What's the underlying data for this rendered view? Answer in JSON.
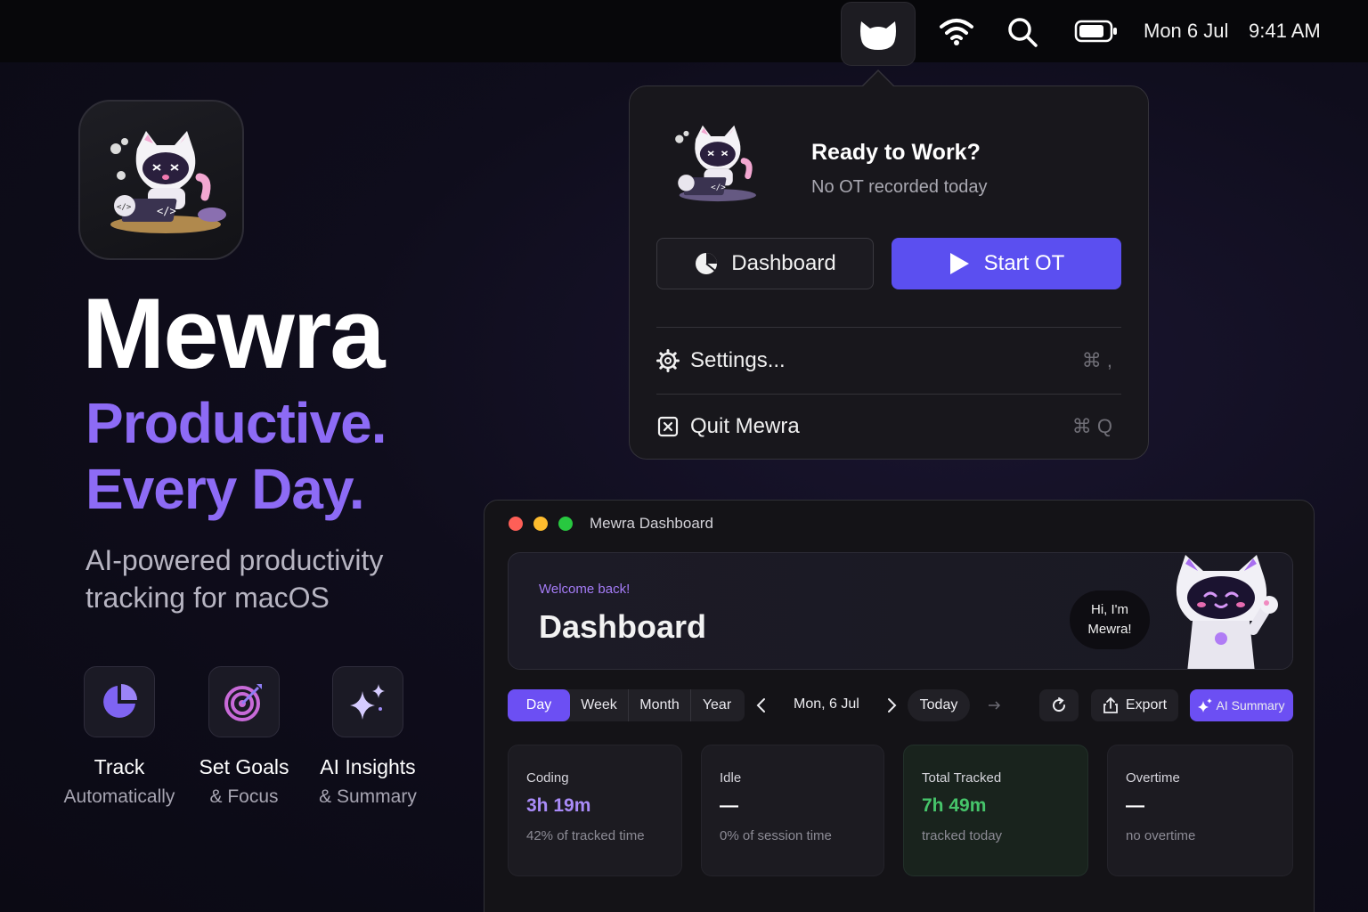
{
  "menubar": {
    "date": "Mon 6 Jul",
    "time": "9:41 AM",
    "icons": [
      "cat-app-icon",
      "wifi-icon",
      "search-icon",
      "battery-icon"
    ]
  },
  "hero": {
    "brand": "Mewra",
    "tagline_line1": "Productive.",
    "tagline_line2": "Every Day.",
    "description": "AI-powered productivity tracking for macOS",
    "accent": "#8d6bf5",
    "features": [
      {
        "icon": "pie-chart-icon",
        "title": "Track",
        "subtitle": "Automatically"
      },
      {
        "icon": "target-icon",
        "title": "Set Goals",
        "subtitle": "& Focus"
      },
      {
        "icon": "sparkles-icon",
        "title": "AI Insights",
        "subtitle": "& Summary"
      }
    ]
  },
  "popover": {
    "title": "Ready to Work?",
    "subtitle": "No OT recorded today",
    "dashboard_label": "Dashboard",
    "start_label": "Start OT",
    "settings_label": "Settings...",
    "settings_shortcut": "⌘ ,",
    "quit_label": "Quit Mewra",
    "quit_shortcut": "⌘ Q",
    "start_color": "#5b4ff0"
  },
  "dashboard": {
    "window_title": "Mewra Dashboard",
    "welcome": "Welcome back!",
    "title": "Dashboard",
    "bubble_line1": "Hi, I'm",
    "bubble_line2": "Mewra!",
    "ranges": [
      "Day",
      "Week",
      "Month",
      "Year"
    ],
    "active_range": "Day",
    "date": "Mon, 6 Jul",
    "today_label": "Today",
    "export_label": "Export",
    "ai_summary_label": "AI Summary",
    "stats": [
      {
        "title": "Coding",
        "value": "3h 19m",
        "sub": "42% of tracked time",
        "color": "#a98bf8"
      },
      {
        "title": "Idle",
        "value": "—",
        "sub": "0% of session time",
        "color": "#ffffff"
      },
      {
        "title": "Total Tracked",
        "value": "7h 49m",
        "sub": "tracked today",
        "color": "#46c46a"
      },
      {
        "title": "Overtime",
        "value": "—",
        "sub": "no overtime",
        "color": "#ffffff"
      }
    ]
  }
}
